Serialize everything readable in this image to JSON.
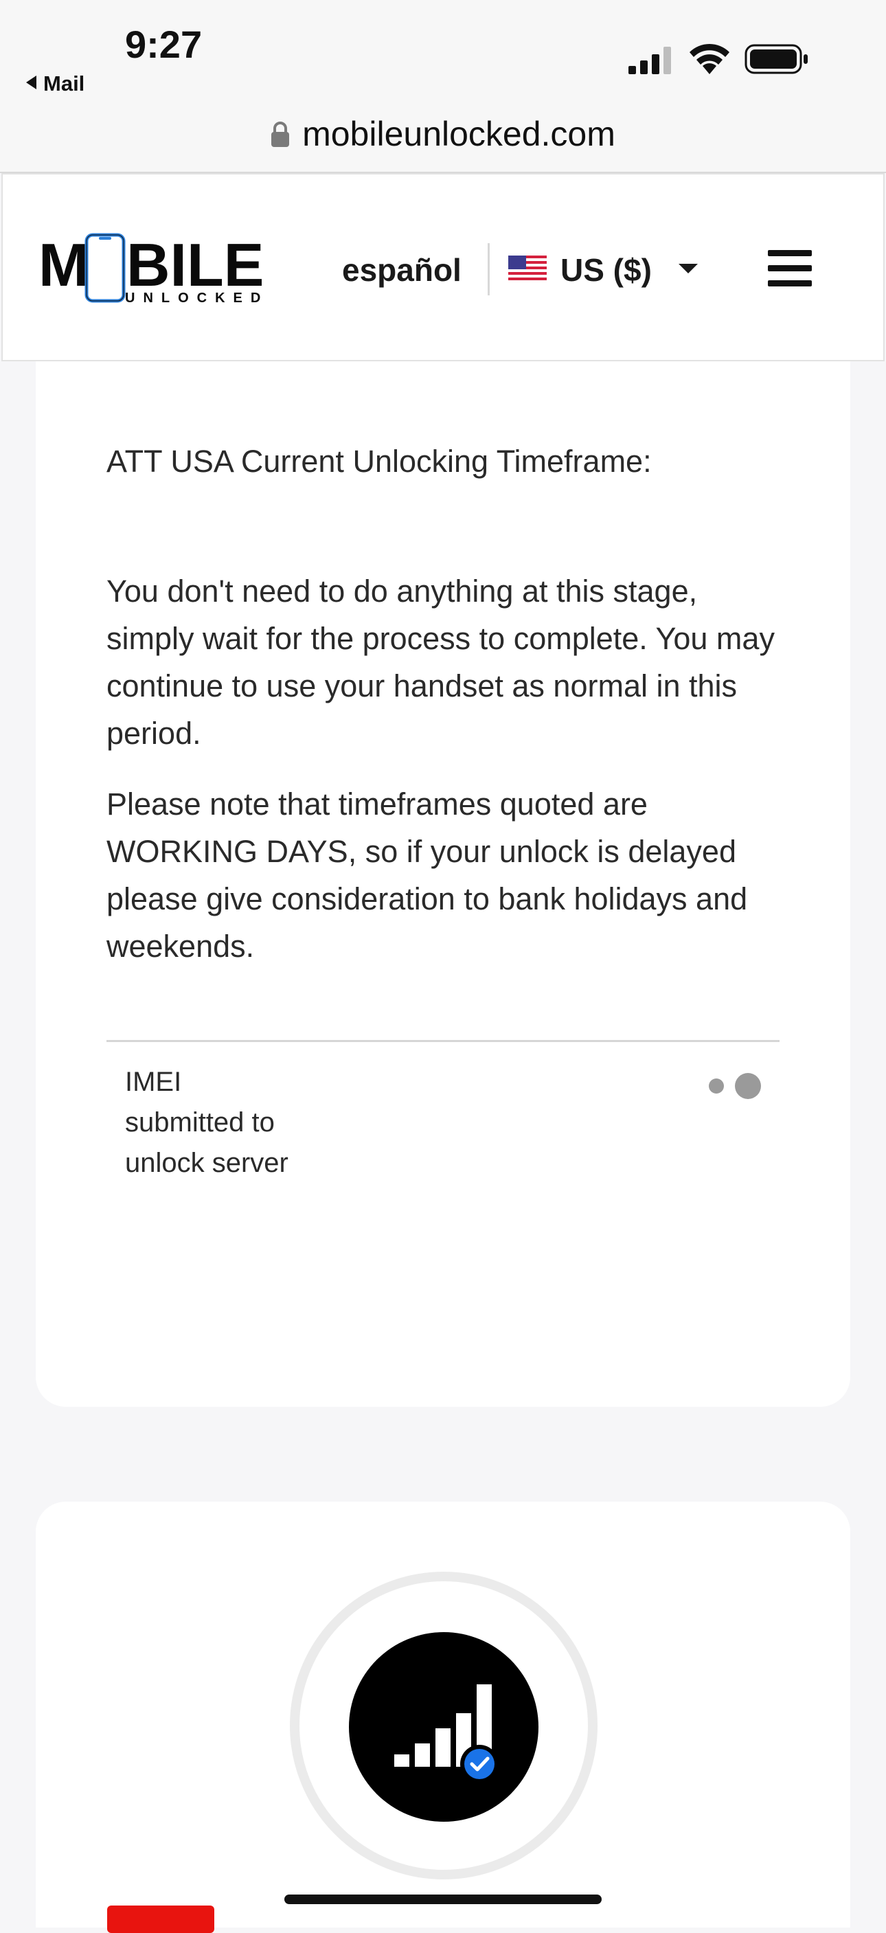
{
  "status_bar": {
    "time": "9:27",
    "back_app": "Mail",
    "icons": [
      "cellular-signal-icon",
      "wifi-icon",
      "battery-icon"
    ]
  },
  "browser": {
    "url": "mobileunlocked.com",
    "lock_icon": "lock-icon"
  },
  "header": {
    "logo_alt": "MOBILE UNLOCKED",
    "language_link": "español",
    "currency_label": "US ($)",
    "flag_icon": "us-flag-icon",
    "menu_icon": "hamburger-menu-icon"
  },
  "card": {
    "title": "ATT USA Current Unlocking Timeframe:",
    "paragraph1": "You don't need to do anything at this stage, simply wait for the process to complete. You may continue to use your handset as normal in this period.",
    "paragraph2": "Please note that timeframes quoted are WORKING DAYS, so if your unlock is delayed please give consideration to bank holidays and weekends.",
    "step_label": "IMEI submitted to unlock server",
    "loading_icon": "loading-dots-icon"
  },
  "unlock_card": {
    "icon": "signal-check-icon"
  },
  "colors": {
    "accent_blue": "#1a73e8",
    "tag_red": "#e8140f",
    "logo_blue": "#2b7fd9"
  }
}
